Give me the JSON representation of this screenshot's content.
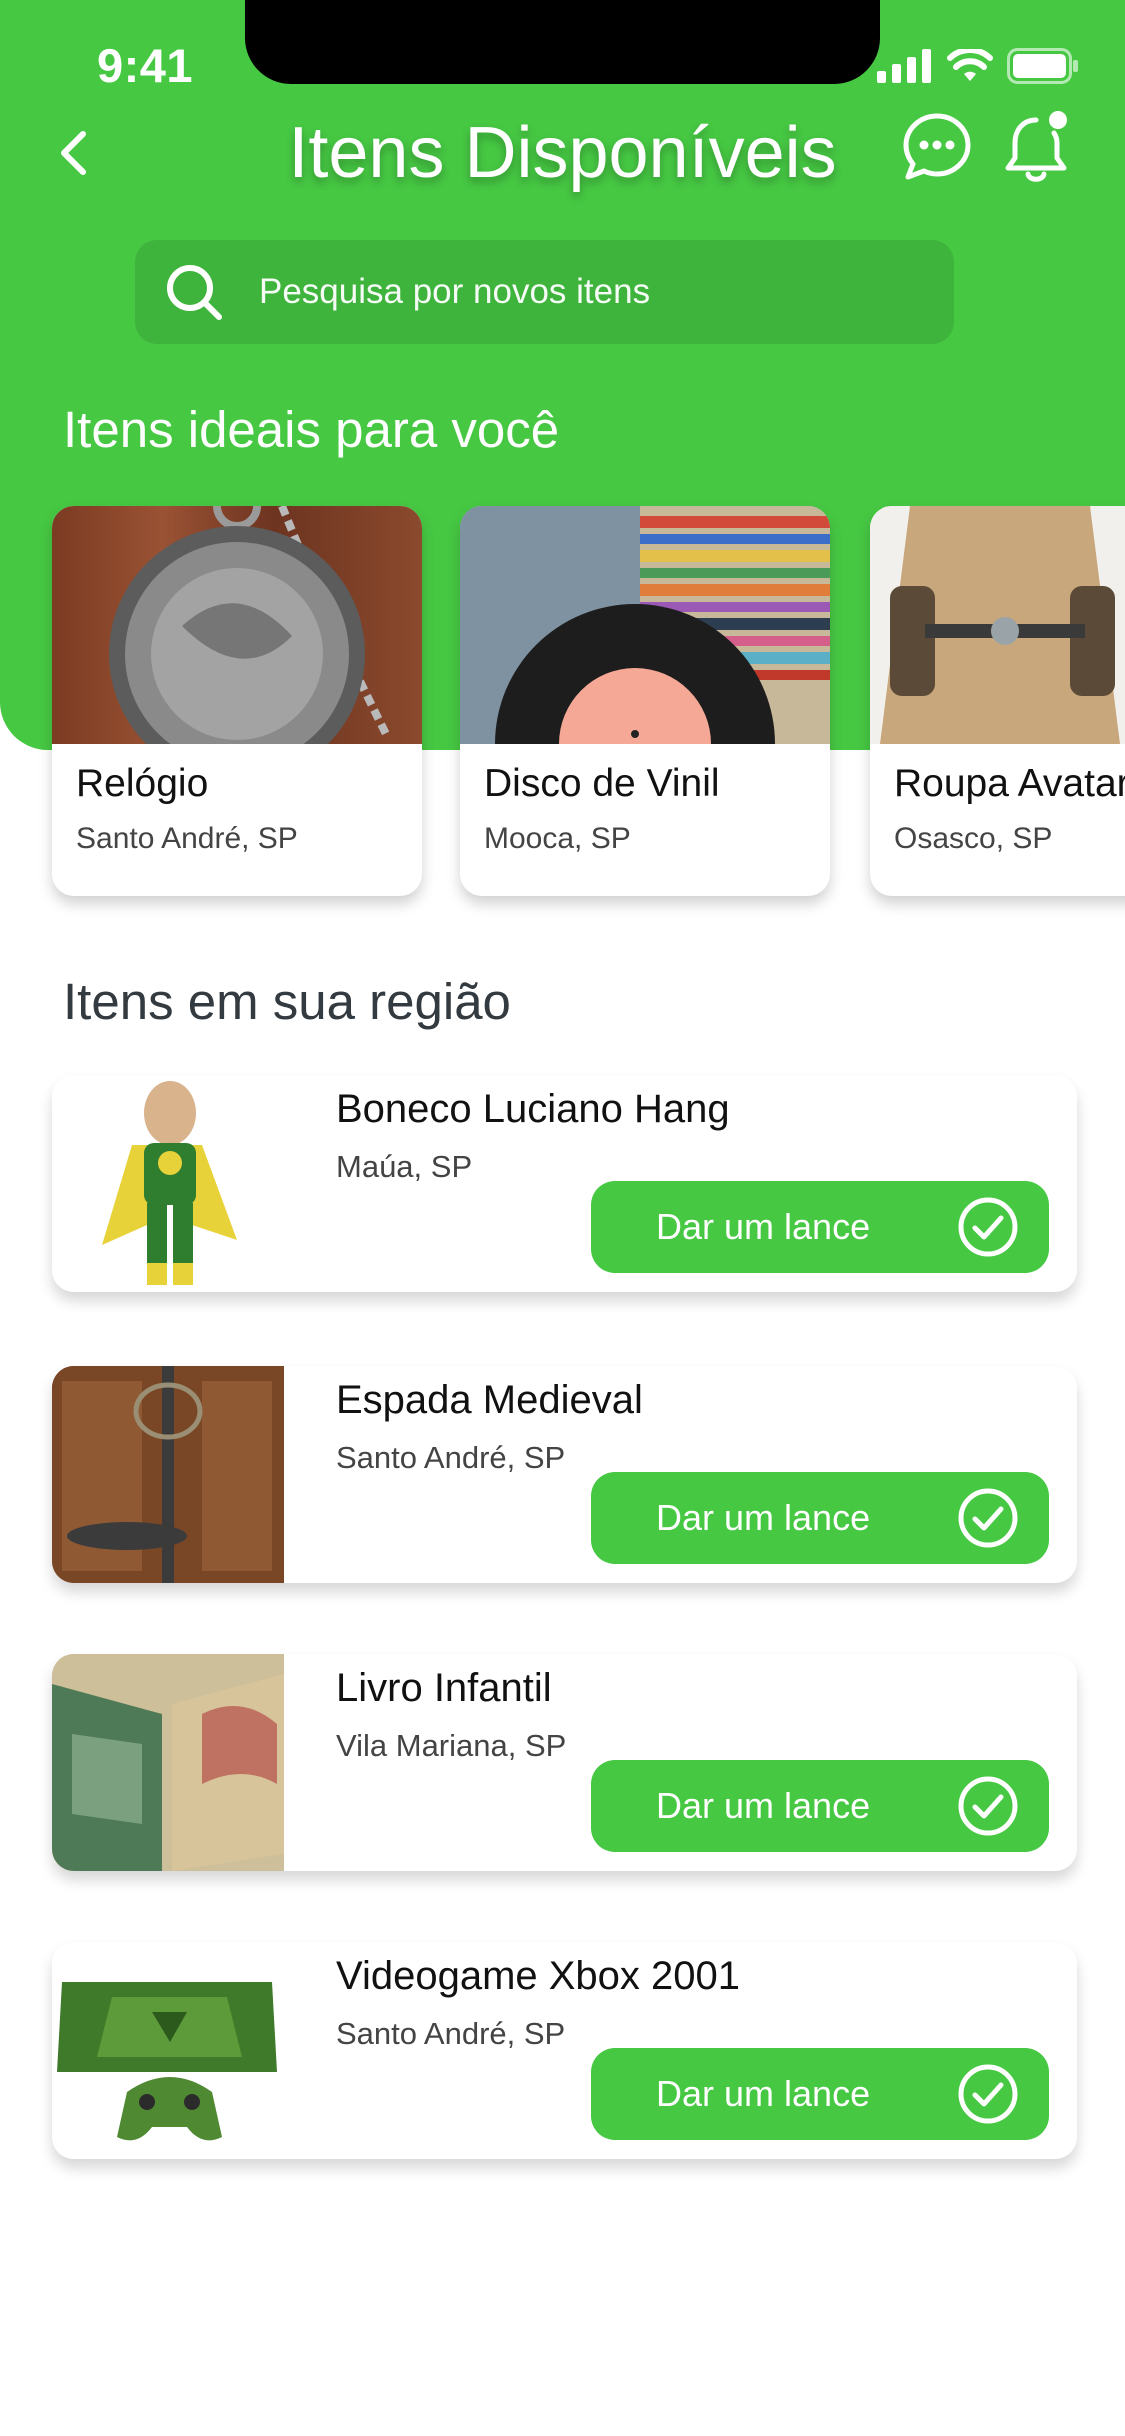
{
  "status_bar": {
    "time": "9:41"
  },
  "header": {
    "title": "Itens Disponíveis"
  },
  "search": {
    "placeholder": "Pesquisa por novos itens"
  },
  "ideal_section": {
    "heading": "Itens ideais para você",
    "items": [
      {
        "title": "Relógio",
        "location": "Santo André, SP"
      },
      {
        "title": "Disco de Vinil",
        "location": "Mooca, SP"
      },
      {
        "title": "Roupa Avatar",
        "location": "Osasco, SP"
      }
    ]
  },
  "region_section": {
    "heading": "Itens em sua região",
    "items": [
      {
        "name": "Boneco Luciano Hang",
        "location": "Maúa, SP",
        "action": "Dar um lance"
      },
      {
        "name": "Espada Medieval",
        "location": "Santo André, SP",
        "action": "Dar um lance"
      },
      {
        "name": "Livro Infantil",
        "location": "Vila Mariana, SP",
        "action": "Dar um lance"
      },
      {
        "name": "Videogame Xbox 2001",
        "location": "Santo André, SP",
        "action": "Dar um lance"
      }
    ]
  },
  "colors": {
    "brand_green": "#46c843",
    "search_green": "#3fb43c",
    "text_dark": "#111111"
  },
  "icons": [
    "back-icon",
    "chat-icon",
    "bell-icon",
    "search-icon",
    "check-circle-icon"
  ]
}
